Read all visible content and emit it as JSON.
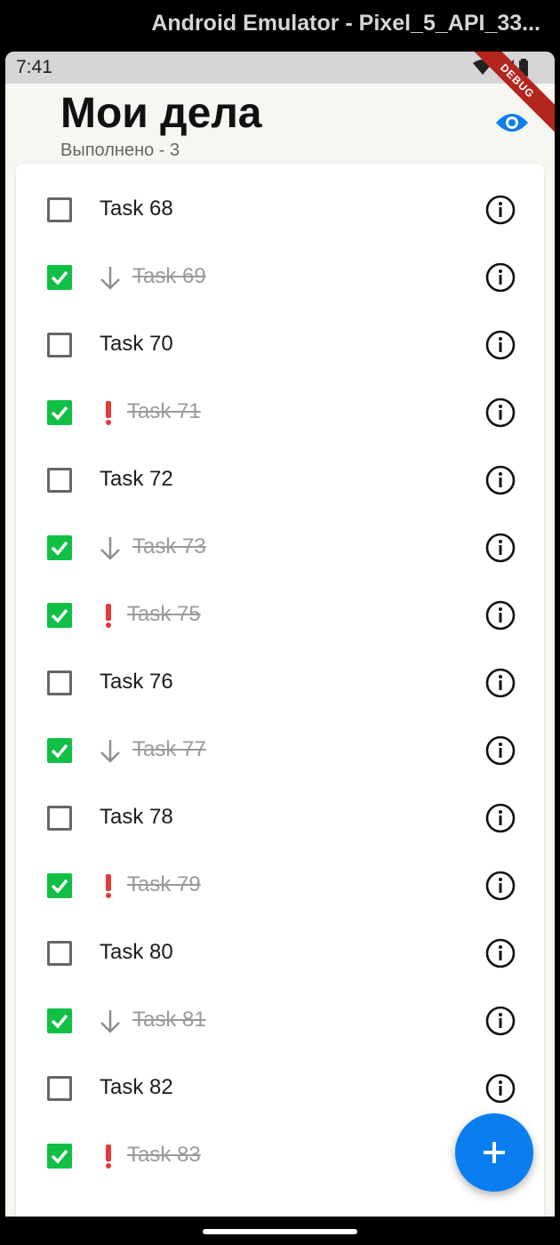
{
  "window": {
    "title": "Android Emulator - Pixel_5_API_33..."
  },
  "status_bar": {
    "time": "7:41",
    "debug_label": "DEBUG"
  },
  "header": {
    "title": "Мои дела",
    "subtitle": "Выполнено - 3",
    "visibility_icon": "eye-icon"
  },
  "colors": {
    "accent": "#0a7ef0",
    "checked": "#10c044",
    "high_priority": "#e53935",
    "low_priority": "#8e8e8e"
  },
  "tasks": [
    {
      "label": "Task 68",
      "done": false,
      "priority": "none"
    },
    {
      "label": "Task 69",
      "done": true,
      "priority": "low"
    },
    {
      "label": "Task 70",
      "done": false,
      "priority": "none"
    },
    {
      "label": "Task 71",
      "done": true,
      "priority": "high"
    },
    {
      "label": "Task 72",
      "done": false,
      "priority": "none"
    },
    {
      "label": "Task 73",
      "done": true,
      "priority": "low"
    },
    {
      "label": "Task 75",
      "done": true,
      "priority": "high"
    },
    {
      "label": "Task 76",
      "done": false,
      "priority": "none"
    },
    {
      "label": "Task 77",
      "done": true,
      "priority": "low"
    },
    {
      "label": "Task 78",
      "done": false,
      "priority": "none"
    },
    {
      "label": "Task 79",
      "done": true,
      "priority": "high"
    },
    {
      "label": "Task 80",
      "done": false,
      "priority": "none"
    },
    {
      "label": "Task 81",
      "done": true,
      "priority": "low"
    },
    {
      "label": "Task 82",
      "done": false,
      "priority": "none"
    },
    {
      "label": "Task 83",
      "done": true,
      "priority": "high"
    }
  ],
  "fab": {
    "icon": "plus-icon"
  }
}
